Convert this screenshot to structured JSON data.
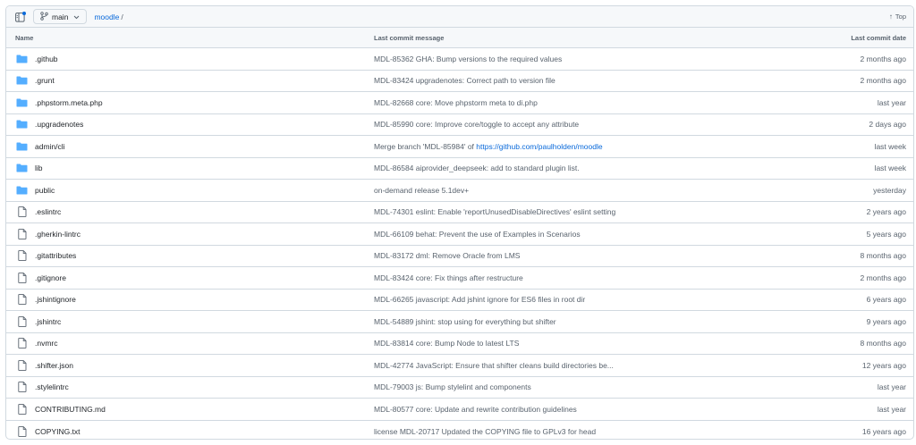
{
  "colors": {
    "accent": "#0969da",
    "folder": "#54aeff",
    "muted": "#59636e"
  },
  "topbar": {
    "branch": "main",
    "repo": "moodle",
    "sep": "/",
    "top_label": "Top"
  },
  "columns": {
    "name": "Name",
    "message": "Last commit message",
    "date": "Last commit date"
  },
  "rows": [
    {
      "icon": "folder-icon",
      "name": ".github",
      "message": "MDL-85362 GHA: Bump versions to the required values",
      "date": "2 months ago"
    },
    {
      "icon": "folder-icon",
      "name": ".grunt",
      "message": "MDL-83424 upgradenotes: Correct path to version file",
      "date": "2 months ago"
    },
    {
      "icon": "folder-icon",
      "name": ".phpstorm.meta.php",
      "message": "MDL-82668 core: Move phpstorm meta to di.php",
      "date": "last year"
    },
    {
      "icon": "folder-icon",
      "name": ".upgradenotes",
      "message": "MDL-85990 core: Improve core/toggle to accept any attribute",
      "date": "2 days ago"
    },
    {
      "icon": "folder-icon",
      "name": "admin/cli",
      "message": "Merge branch 'MDL-85984' of ",
      "message_link": "https://github.com/paulholden/moodle",
      "date": "last week"
    },
    {
      "icon": "folder-icon",
      "name": "lib",
      "message": "MDL-86584 aiprovider_deepseek: add to standard plugin list.",
      "date": "last week"
    },
    {
      "icon": "folder-icon",
      "name": "public",
      "message": "on-demand release 5.1dev+",
      "date": "yesterday"
    },
    {
      "icon": "file-icon",
      "name": ".eslintrc",
      "message": "MDL-74301 eslint: Enable 'reportUnusedDisableDirectives' eslint setting",
      "date": "2 years ago"
    },
    {
      "icon": "file-icon",
      "name": ".gherkin-lintrc",
      "message": "MDL-66109 behat: Prevent the use of Examples in Scenarios",
      "date": "5 years ago"
    },
    {
      "icon": "file-icon",
      "name": ".gitattributes",
      "message": "MDL-83172 dml: Remove Oracle from LMS",
      "date": "8 months ago"
    },
    {
      "icon": "file-icon",
      "name": ".gitignore",
      "message": "MDL-83424 core: Fix things after restructure",
      "date": "2 months ago"
    },
    {
      "icon": "file-icon",
      "name": ".jshintignore",
      "message": "MDL-66265 javascript: Add jshint ignore for ES6 files in root dir",
      "date": "6 years ago"
    },
    {
      "icon": "file-icon",
      "name": ".jshintrc",
      "message": "MDL-54889 jshint: stop using for everything but shifter",
      "date": "9 years ago"
    },
    {
      "icon": "file-icon",
      "name": ".nvmrc",
      "message": "MDL-83814 core: Bump Node to latest LTS",
      "date": "8 months ago"
    },
    {
      "icon": "file-icon",
      "name": ".shifter.json",
      "message": "MDL-42774 JavaScript: Ensure that shifter cleans build directories be...",
      "date": "12 years ago"
    },
    {
      "icon": "file-icon",
      "name": ".stylelintrc",
      "message": "MDL-79003 js: Bump stylelint and components",
      "date": "last year"
    },
    {
      "icon": "file-icon",
      "name": "CONTRIBUTING.md",
      "message": "MDL-80577 core: Update and rewrite contribution guidelines",
      "date": "last year"
    },
    {
      "icon": "file-icon",
      "name": "COPYING.txt",
      "message": "license MDL-20717 Updated the COPYING file to GPLv3 for head",
      "date": "16 years ago"
    }
  ]
}
